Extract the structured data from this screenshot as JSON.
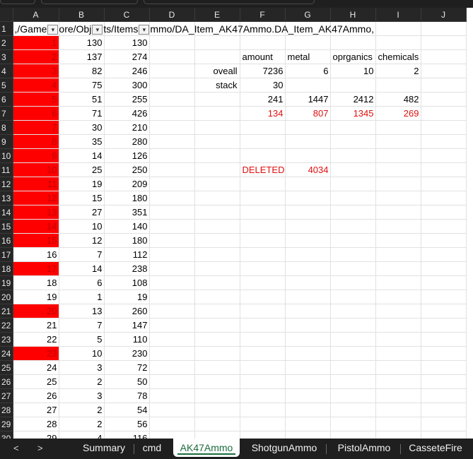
{
  "columns": [
    "A",
    "B",
    "C",
    "D",
    "E",
    "F",
    "G",
    "H",
    "I",
    "J"
  ],
  "header_row": {
    "row": "1",
    "prefix": ",/Game",
    "seg2": "ore/Obj",
    "seg3": "ts/Items",
    "seg4": "mmo/DA_Item_AK47Ammo.DA_Item_AK47Ammo,",
    "filter_glyph_sorted": "▾",
    "filter_glyph": "▾"
  },
  "rows": [
    {
      "r": "2",
      "a": "1",
      "b": "130",
      "c": "130",
      "red": true
    },
    {
      "r": "3",
      "a": "2",
      "b": "137",
      "c": "274",
      "red": true
    },
    {
      "r": "4",
      "a": "3",
      "b": "82",
      "c": "246",
      "red": true
    },
    {
      "r": "5",
      "a": "4",
      "b": "75",
      "c": "300",
      "red": true
    },
    {
      "r": "6",
      "a": "5",
      "b": "51",
      "c": "255",
      "red": true
    },
    {
      "r": "7",
      "a": "6",
      "b": "71",
      "c": "426",
      "red": true
    },
    {
      "r": "8",
      "a": "7",
      "b": "30",
      "c": "210",
      "red": true
    },
    {
      "r": "9",
      "a": "8",
      "b": "35",
      "c": "280",
      "red": true
    },
    {
      "r": "10",
      "a": "9",
      "b": "14",
      "c": "126",
      "red": true
    },
    {
      "r": "11",
      "a": "10",
      "b": "25",
      "c": "250",
      "red": true
    },
    {
      "r": "12",
      "a": "11",
      "b": "19",
      "c": "209",
      "red": true
    },
    {
      "r": "13",
      "a": "12",
      "b": "15",
      "c": "180",
      "red": true
    },
    {
      "r": "14",
      "a": "13",
      "b": "27",
      "c": "351",
      "red": true
    },
    {
      "r": "15",
      "a": "14",
      "b": "10",
      "c": "140",
      "red": true
    },
    {
      "r": "16",
      "a": "15",
      "b": "12",
      "c": "180",
      "red": true
    },
    {
      "r": "17",
      "a": "16",
      "b": "7",
      "c": "112",
      "red": false
    },
    {
      "r": "18",
      "a": "17",
      "b": "14",
      "c": "238",
      "red": true
    },
    {
      "r": "19",
      "a": "18",
      "b": "6",
      "c": "108",
      "red": false
    },
    {
      "r": "20",
      "a": "19",
      "b": "1",
      "c": "19",
      "red": false
    },
    {
      "r": "21",
      "a": "20",
      "b": "13",
      "c": "260",
      "red": true
    },
    {
      "r": "22",
      "a": "21",
      "b": "7",
      "c": "147",
      "red": false
    },
    {
      "r": "23",
      "a": "22",
      "b": "5",
      "c": "110",
      "red": false
    },
    {
      "r": "24",
      "a": "23",
      "b": "10",
      "c": "230",
      "red": true
    },
    {
      "r": "25",
      "a": "24",
      "b": "3",
      "c": "72",
      "red": false
    },
    {
      "r": "26",
      "a": "25",
      "b": "2",
      "c": "50",
      "red": false
    },
    {
      "r": "27",
      "a": "26",
      "b": "3",
      "c": "78",
      "red": false
    },
    {
      "r": "28",
      "a": "27",
      "b": "2",
      "c": "54",
      "red": false
    },
    {
      "r": "29",
      "a": "28",
      "b": "2",
      "c": "56",
      "red": false
    },
    {
      "r": "30",
      "a": "29",
      "b": "4",
      "c": "116",
      "red": false
    }
  ],
  "summary": {
    "row3": {
      "f": "amount",
      "g": "metal",
      "h": "oprganics",
      "i": "chemicals"
    },
    "row4": {
      "e": "oveall",
      "f": "7236",
      "g": "6",
      "h": "10",
      "i": "2"
    },
    "row5": {
      "e": "stack",
      "f": "30"
    },
    "row6": {
      "f": "241",
      "g": "1447",
      "h": "2412",
      "i": "482"
    },
    "row7": {
      "f": "134",
      "g": "807",
      "h": "1345",
      "i": "269"
    },
    "row11": {
      "f": "DELETED",
      "g": "4034"
    }
  },
  "colors": {
    "deleted_fill": "#ff0000",
    "red_text": "#e01010",
    "active_tab": "#1a6b3c"
  },
  "tabs": {
    "nav_prev": "<",
    "nav_next": ">",
    "items": [
      {
        "label": "Summary",
        "active": false
      },
      {
        "label": "cmd",
        "active": false
      },
      {
        "label": "AK47Ammo",
        "active": true
      },
      {
        "label": "ShotgunAmmo",
        "active": false
      },
      {
        "label": "PistolAmmo",
        "active": false
      },
      {
        "label": "CasseteFire",
        "active": false
      }
    ]
  }
}
